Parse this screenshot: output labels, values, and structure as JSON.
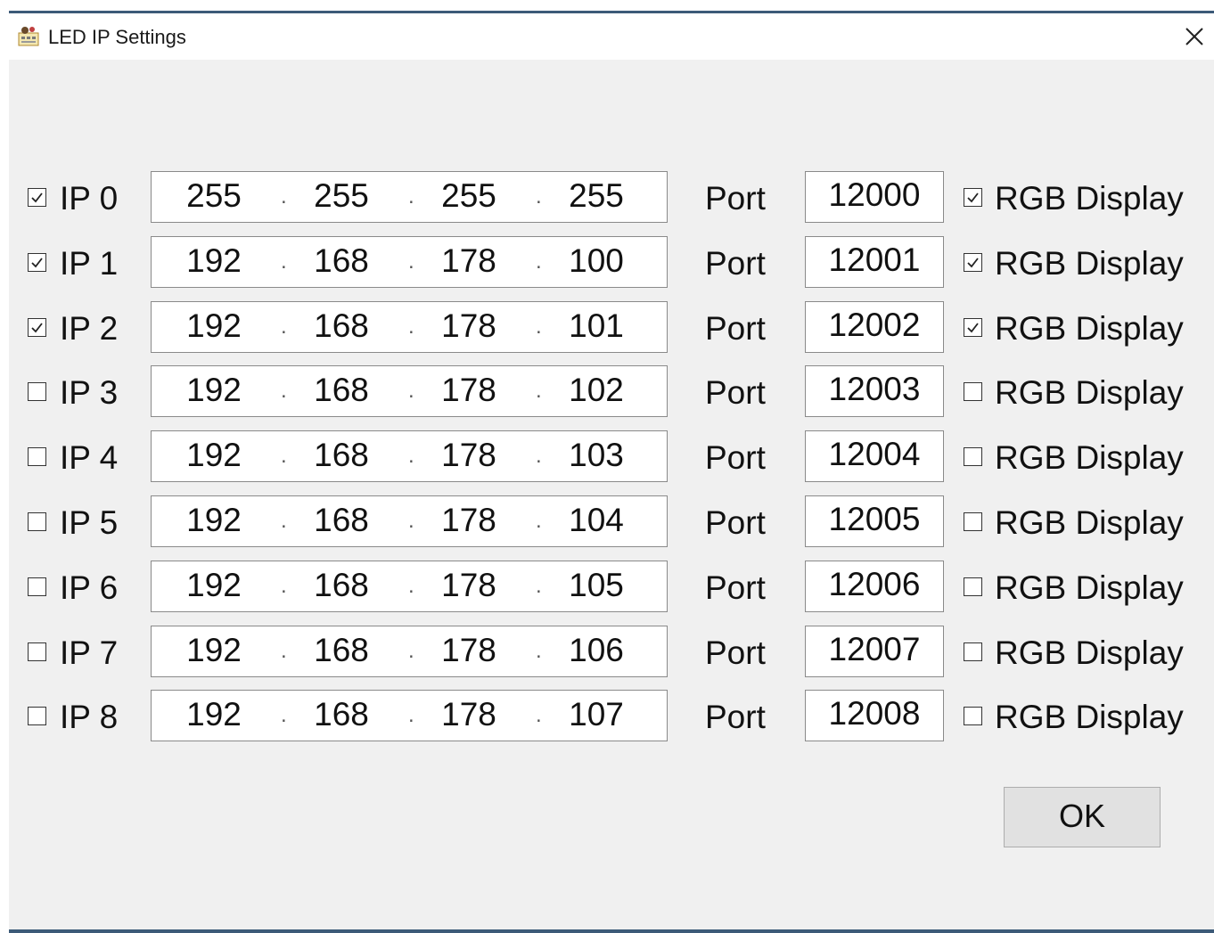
{
  "window": {
    "title": "LED IP Settings"
  },
  "rows": [
    {
      "label": "IP 0",
      "checked": true,
      "octets": [
        "255",
        "255",
        "255",
        "255"
      ],
      "port_label": "Port",
      "port": "12000",
      "rgb_label": "RGB Display",
      "rgb_checked": true
    },
    {
      "label": "IP 1",
      "checked": true,
      "octets": [
        "192",
        "168",
        "178",
        "100"
      ],
      "port_label": "Port",
      "port": "12001",
      "rgb_label": "RGB Display",
      "rgb_checked": true
    },
    {
      "label": "IP 2",
      "checked": true,
      "octets": [
        "192",
        "168",
        "178",
        "101"
      ],
      "port_label": "Port",
      "port": "12002",
      "rgb_label": "RGB Display",
      "rgb_checked": true
    },
    {
      "label": "IP 3",
      "checked": false,
      "octets": [
        "192",
        "168",
        "178",
        "102"
      ],
      "port_label": "Port",
      "port": "12003",
      "rgb_label": "RGB Display",
      "rgb_checked": false
    },
    {
      "label": "IP 4",
      "checked": false,
      "octets": [
        "192",
        "168",
        "178",
        "103"
      ],
      "port_label": "Port",
      "port": "12004",
      "rgb_label": "RGB Display",
      "rgb_checked": false
    },
    {
      "label": "IP 5",
      "checked": false,
      "octets": [
        "192",
        "168",
        "178",
        "104"
      ],
      "port_label": "Port",
      "port": "12005",
      "rgb_label": "RGB Display",
      "rgb_checked": false
    },
    {
      "label": "IP 6",
      "checked": false,
      "octets": [
        "192",
        "168",
        "178",
        "105"
      ],
      "port_label": "Port",
      "port": "12006",
      "rgb_label": "RGB Display",
      "rgb_checked": false
    },
    {
      "label": "IP 7",
      "checked": false,
      "octets": [
        "192",
        "168",
        "178",
        "106"
      ],
      "port_label": "Port",
      "port": "12007",
      "rgb_label": "RGB Display",
      "rgb_checked": false
    },
    {
      "label": "IP 8",
      "checked": false,
      "octets": [
        "192",
        "168",
        "178",
        "107"
      ],
      "port_label": "Port",
      "port": "12008",
      "rgb_label": "RGB Display",
      "rgb_checked": false
    }
  ],
  "ok_button": {
    "label": "OK"
  },
  "icons": {
    "app": "led-app-icon",
    "close": "close-icon"
  }
}
